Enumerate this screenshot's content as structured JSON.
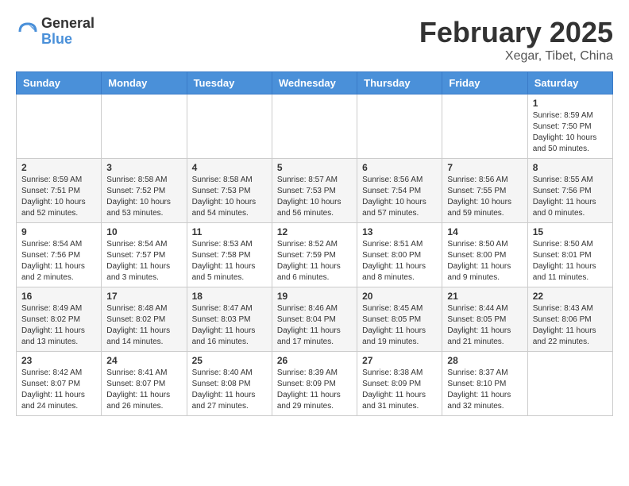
{
  "header": {
    "logo_general": "General",
    "logo_blue": "Blue",
    "month_title": "February 2025",
    "location": "Xegar, Tibet, China"
  },
  "days_of_week": [
    "Sunday",
    "Monday",
    "Tuesday",
    "Wednesday",
    "Thursday",
    "Friday",
    "Saturday"
  ],
  "weeks": [
    [
      {
        "day": "",
        "info": ""
      },
      {
        "day": "",
        "info": ""
      },
      {
        "day": "",
        "info": ""
      },
      {
        "day": "",
        "info": ""
      },
      {
        "day": "",
        "info": ""
      },
      {
        "day": "",
        "info": ""
      },
      {
        "day": "1",
        "info": "Sunrise: 8:59 AM\nSunset: 7:50 PM\nDaylight: 10 hours\nand 50 minutes."
      }
    ],
    [
      {
        "day": "2",
        "info": "Sunrise: 8:59 AM\nSunset: 7:51 PM\nDaylight: 10 hours\nand 52 minutes."
      },
      {
        "day": "3",
        "info": "Sunrise: 8:58 AM\nSunset: 7:52 PM\nDaylight: 10 hours\nand 53 minutes."
      },
      {
        "day": "4",
        "info": "Sunrise: 8:58 AM\nSunset: 7:53 PM\nDaylight: 10 hours\nand 54 minutes."
      },
      {
        "day": "5",
        "info": "Sunrise: 8:57 AM\nSunset: 7:53 PM\nDaylight: 10 hours\nand 56 minutes."
      },
      {
        "day": "6",
        "info": "Sunrise: 8:56 AM\nSunset: 7:54 PM\nDaylight: 10 hours\nand 57 minutes."
      },
      {
        "day": "7",
        "info": "Sunrise: 8:56 AM\nSunset: 7:55 PM\nDaylight: 10 hours\nand 59 minutes."
      },
      {
        "day": "8",
        "info": "Sunrise: 8:55 AM\nSunset: 7:56 PM\nDaylight: 11 hours\nand 0 minutes."
      }
    ],
    [
      {
        "day": "9",
        "info": "Sunrise: 8:54 AM\nSunset: 7:56 PM\nDaylight: 11 hours\nand 2 minutes."
      },
      {
        "day": "10",
        "info": "Sunrise: 8:54 AM\nSunset: 7:57 PM\nDaylight: 11 hours\nand 3 minutes."
      },
      {
        "day": "11",
        "info": "Sunrise: 8:53 AM\nSunset: 7:58 PM\nDaylight: 11 hours\nand 5 minutes."
      },
      {
        "day": "12",
        "info": "Sunrise: 8:52 AM\nSunset: 7:59 PM\nDaylight: 11 hours\nand 6 minutes."
      },
      {
        "day": "13",
        "info": "Sunrise: 8:51 AM\nSunset: 8:00 PM\nDaylight: 11 hours\nand 8 minutes."
      },
      {
        "day": "14",
        "info": "Sunrise: 8:50 AM\nSunset: 8:00 PM\nDaylight: 11 hours\nand 9 minutes."
      },
      {
        "day": "15",
        "info": "Sunrise: 8:50 AM\nSunset: 8:01 PM\nDaylight: 11 hours\nand 11 minutes."
      }
    ],
    [
      {
        "day": "16",
        "info": "Sunrise: 8:49 AM\nSunset: 8:02 PM\nDaylight: 11 hours\nand 13 minutes."
      },
      {
        "day": "17",
        "info": "Sunrise: 8:48 AM\nSunset: 8:02 PM\nDaylight: 11 hours\nand 14 minutes."
      },
      {
        "day": "18",
        "info": "Sunrise: 8:47 AM\nSunset: 8:03 PM\nDaylight: 11 hours\nand 16 minutes."
      },
      {
        "day": "19",
        "info": "Sunrise: 8:46 AM\nSunset: 8:04 PM\nDaylight: 11 hours\nand 17 minutes."
      },
      {
        "day": "20",
        "info": "Sunrise: 8:45 AM\nSunset: 8:05 PM\nDaylight: 11 hours\nand 19 minutes."
      },
      {
        "day": "21",
        "info": "Sunrise: 8:44 AM\nSunset: 8:05 PM\nDaylight: 11 hours\nand 21 minutes."
      },
      {
        "day": "22",
        "info": "Sunrise: 8:43 AM\nSunset: 8:06 PM\nDaylight: 11 hours\nand 22 minutes."
      }
    ],
    [
      {
        "day": "23",
        "info": "Sunrise: 8:42 AM\nSunset: 8:07 PM\nDaylight: 11 hours\nand 24 minutes."
      },
      {
        "day": "24",
        "info": "Sunrise: 8:41 AM\nSunset: 8:07 PM\nDaylight: 11 hours\nand 26 minutes."
      },
      {
        "day": "25",
        "info": "Sunrise: 8:40 AM\nSunset: 8:08 PM\nDaylight: 11 hours\nand 27 minutes."
      },
      {
        "day": "26",
        "info": "Sunrise: 8:39 AM\nSunset: 8:09 PM\nDaylight: 11 hours\nand 29 minutes."
      },
      {
        "day": "27",
        "info": "Sunrise: 8:38 AM\nSunset: 8:09 PM\nDaylight: 11 hours\nand 31 minutes."
      },
      {
        "day": "28",
        "info": "Sunrise: 8:37 AM\nSunset: 8:10 PM\nDaylight: 11 hours\nand 32 minutes."
      },
      {
        "day": "",
        "info": ""
      }
    ]
  ]
}
